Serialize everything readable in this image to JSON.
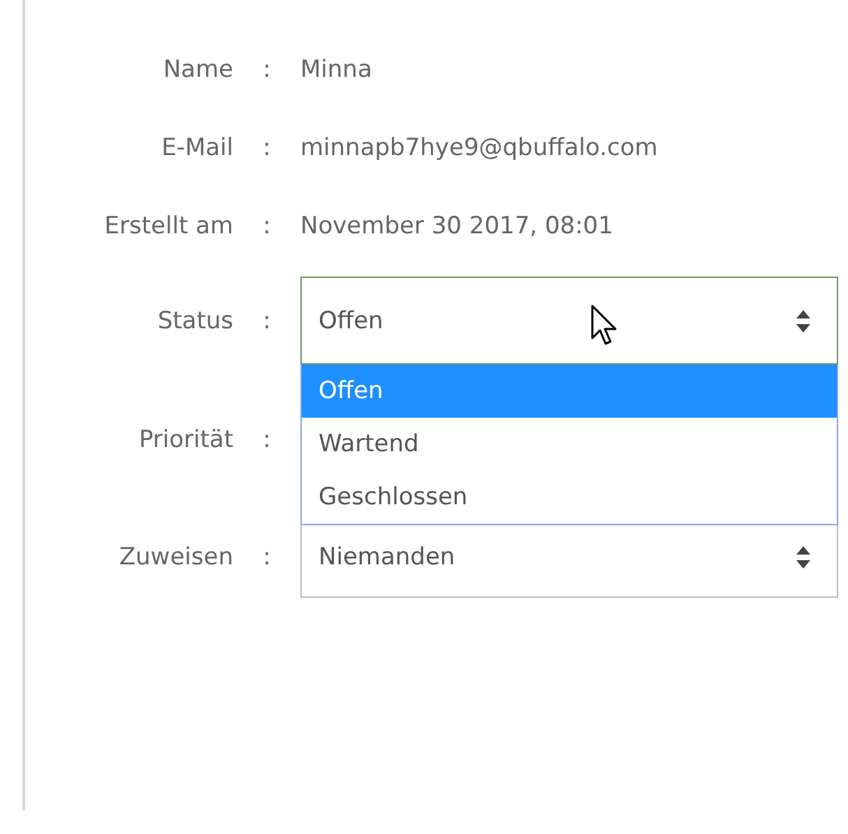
{
  "fields": [
    {
      "kind": "text",
      "label": "Name",
      "separator": ":",
      "value": "Minna"
    },
    {
      "kind": "text",
      "label": "E-Mail",
      "separator": ":",
      "value": "minnapb7hye9@qbuffalo.com"
    },
    {
      "kind": "text",
      "label": "Erstellt am",
      "separator": ":",
      "value": "November 30 2017, 08:01"
    },
    {
      "kind": "select",
      "label": "Status",
      "separator": ":",
      "value": "Offen",
      "focused": true,
      "options": [
        {
          "label": "Offen",
          "selected": true
        },
        {
          "label": "Wartend",
          "selected": false
        },
        {
          "label": "Geschlossen",
          "selected": false
        }
      ]
    },
    {
      "kind": "covered",
      "label": "Priorität",
      "separator": ":"
    },
    {
      "kind": "select",
      "label": "Zuweisen",
      "separator": ":",
      "value": "Niemanden",
      "focused": false
    }
  ]
}
